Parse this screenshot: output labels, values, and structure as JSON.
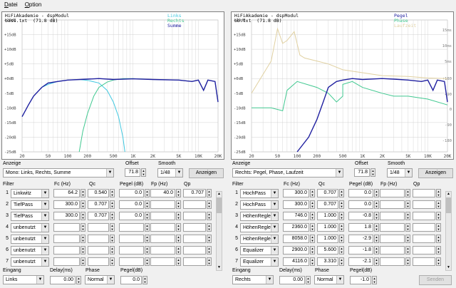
{
  "menu": {
    "datei": "Datei",
    "option": "Option"
  },
  "left": {
    "title1": "HiFiAkademie - dspModul",
    "title2": "bass.txt  (71.8 dB)",
    "legend": [
      {
        "label": "Links",
        "color": "#40c8e0"
      },
      {
        "label": "Rechts",
        "color": "#40c890"
      },
      {
        "label": "Summe",
        "color": "#2020a0"
      }
    ],
    "anzeige_label": "Anzeige",
    "anzeige_value": "Mono: Links, Rechts, Summe",
    "offset_label": "Offset",
    "offset_value": "71.8",
    "smooth_label": "Smooth",
    "smooth_value": "1/48",
    "anzeigen_button": "Anzeigen",
    "filter_headers": {
      "filter": "Filter",
      "fc": "Fc (Hz)",
      "qc": "Qc",
      "pegel": "Pegel (dB)",
      "fp": "Fp (Hz)",
      "qp": "Qp"
    },
    "filters": [
      {
        "n": "1",
        "type": "Linkwitz",
        "fc": "64.2",
        "qc": "0.540",
        "pegel": "0.0",
        "fp": "40.0",
        "qp": "0.707"
      },
      {
        "n": "2",
        "type": "TiefPass",
        "fc": "300.0",
        "qc": "0.707",
        "pegel": "0.0",
        "fp": "",
        "qp": ""
      },
      {
        "n": "3",
        "type": "TiefPass",
        "fc": "300.0",
        "qc": "0.707",
        "pegel": "0.0",
        "fp": "",
        "qp": ""
      },
      {
        "n": "4",
        "type": "unbenutzt",
        "fc": "",
        "qc": "",
        "pegel": "",
        "fp": "",
        "qp": ""
      },
      {
        "n": "5",
        "type": "unbenutzt",
        "fc": "",
        "qc": "",
        "pegel": "",
        "fp": "",
        "qp": ""
      },
      {
        "n": "6",
        "type": "unbenutzt",
        "fc": "",
        "qc": "",
        "pegel": "",
        "fp": "",
        "qp": ""
      },
      {
        "n": "7",
        "type": "unbenutzt",
        "fc": "",
        "qc": "",
        "pegel": "",
        "fp": "",
        "qp": ""
      }
    ],
    "eingang_label": "Eingang",
    "eingang_value": "Links",
    "delay_label": "Delay(ms)",
    "delay_value": "0.00",
    "phase_label": "Phase",
    "phase_value": "Normal",
    "pegel_label": "Pegel(dB)",
    "pegel_value": "0.0"
  },
  "right": {
    "title1": "HiFiAkademie - dspModul",
    "title2": "bb.txt  (71.8 dB)",
    "legend": [
      {
        "label": "Pegel",
        "color": "#2020a0"
      },
      {
        "label": "Phase",
        "color": "#40c890"
      },
      {
        "label": "Laufzeit",
        "color": "#e0d0a0"
      }
    ],
    "anzeige_label": "Anzeige",
    "anzeige_value": "Rechts: Pegel, Phase, Laufzeit",
    "offset_label": "Offset",
    "offset_value": "71.8",
    "smooth_label": "Smooth",
    "smooth_value": "1/48",
    "anzeigen_button": "Anzeigen",
    "filter_headers": {
      "filter": "Filter",
      "fc": "Fc (Hz)",
      "qc": "Qc",
      "pegel": "Pegel (dB)",
      "fp": "Fp (Hz)",
      "qp": "Qp"
    },
    "filters": [
      {
        "n": "1",
        "type": "HochPass",
        "fc": "300.0",
        "qc": "0.707",
        "pegel": "0.0",
        "fp": "",
        "qp": ""
      },
      {
        "n": "2",
        "type": "HochPass",
        "fc": "300.0",
        "qc": "0.707",
        "pegel": "0.0",
        "fp": "",
        "qp": ""
      },
      {
        "n": "3",
        "type": "HöhenRegler",
        "fc": "746.0",
        "qc": "1.000",
        "pegel": "-0.8",
        "fp": "",
        "qp": ""
      },
      {
        "n": "4",
        "type": "HöhenRegler",
        "fc": "2360.0",
        "qc": "1.000",
        "pegel": "1.8",
        "fp": "",
        "qp": ""
      },
      {
        "n": "5",
        "type": "HöhenRegler",
        "fc": "8058.0",
        "qc": "1.000",
        "pegel": "-2.9",
        "fp": "",
        "qp": ""
      },
      {
        "n": "6",
        "type": "Equalizer",
        "fc": "2900.0",
        "qc": "5.600",
        "pegel": "-1.8",
        "fp": "",
        "qp": ""
      },
      {
        "n": "7",
        "type": "Equalizer",
        "fc": "4116.0",
        "qc": "3.310",
        "pegel": "-2.1",
        "fp": "",
        "qp": ""
      }
    ],
    "eingang_label": "Eingang",
    "eingang_value": "Rechts",
    "delay_label": "Delay(ms)",
    "delay_value": "0.00",
    "phase_label": "Phase",
    "phase_value": "Normal",
    "pegel_label": "Pegel(dB)",
    "pegel_value": "-1.0",
    "senden_button": "Senden",
    "y2_labels": [
      "15ms",
      "10ms",
      "5ms",
      "+180",
      "+90",
      "0",
      "-90",
      "-180"
    ]
  },
  "y_labels": [
    "+20dB",
    "+15dB",
    "+10dB",
    "+5dB",
    "+0dB",
    "-5dB",
    "-10dB",
    "-15dB",
    "-20dB",
    "-25dB"
  ],
  "x_labels": [
    "20",
    "50",
    "100",
    "200",
    "500",
    "1K",
    "2K",
    "5K",
    "10K",
    "20K"
  ]
}
